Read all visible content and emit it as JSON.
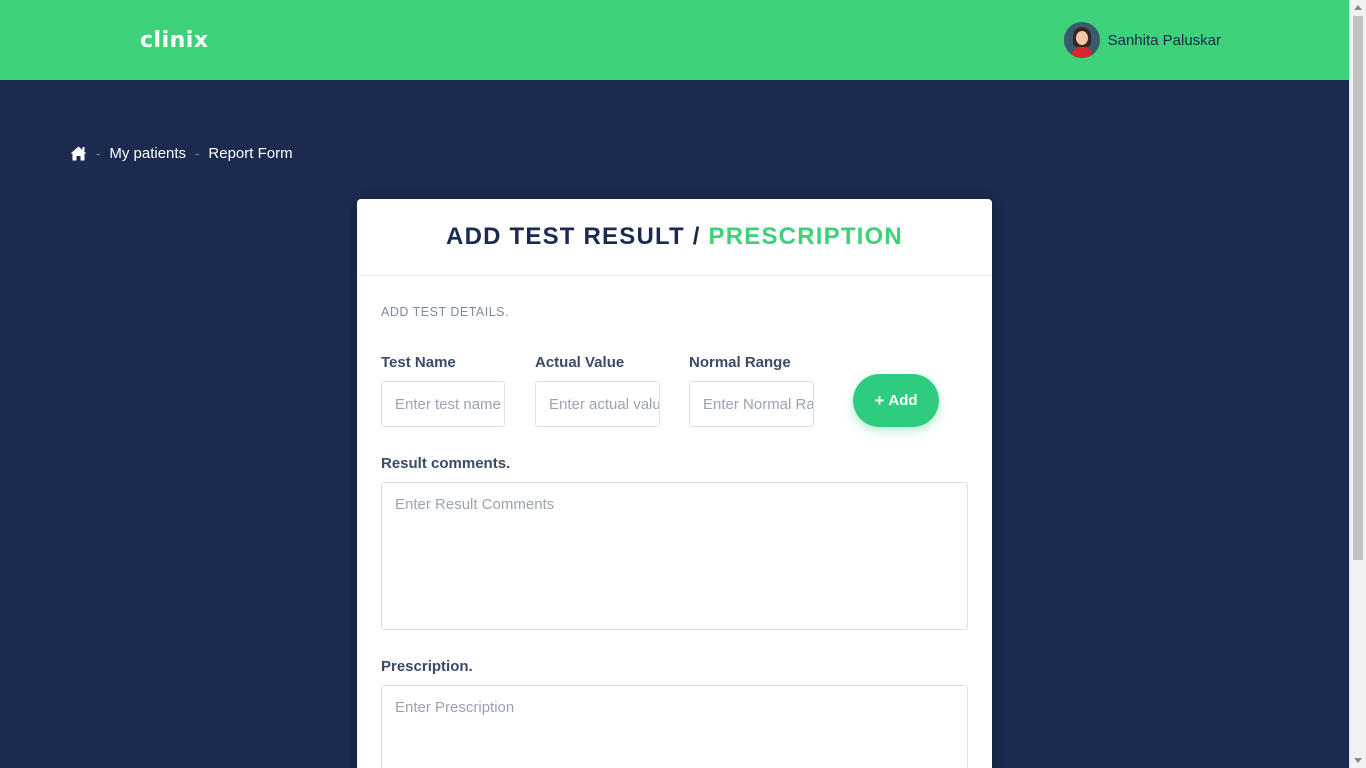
{
  "header": {
    "logo": "clinix",
    "user_name": "Sanhita Paluskar",
    "bg_color": "#3dd27a"
  },
  "breadcrumb": {
    "home_icon": "home-icon",
    "items": [
      "My patients",
      "Report Form"
    ],
    "separator": "-"
  },
  "form": {
    "title_main": "ADD TEST RESULT / ",
    "title_accent": "PRESCRIPTION",
    "section_label": "ADD TEST DETAILS.",
    "test_name": {
      "label": "Test Name",
      "placeholder": "Enter test name"
    },
    "actual_value": {
      "label": "Actual Value",
      "placeholder": "Enter actual value"
    },
    "normal_range": {
      "label": "Normal Range",
      "placeholder": "Enter Normal Range"
    },
    "add_button": {
      "icon": "plus-icon",
      "label": "Add"
    },
    "result_comments": {
      "label": "Result comments.",
      "placeholder": "Enter Result Comments"
    },
    "prescription": {
      "label": "Prescription.",
      "placeholder": "Enter Prescription"
    }
  },
  "colors": {
    "page_bg": "#1b2a4e",
    "accent": "#3dd27a",
    "button": "#2ecc7f"
  }
}
